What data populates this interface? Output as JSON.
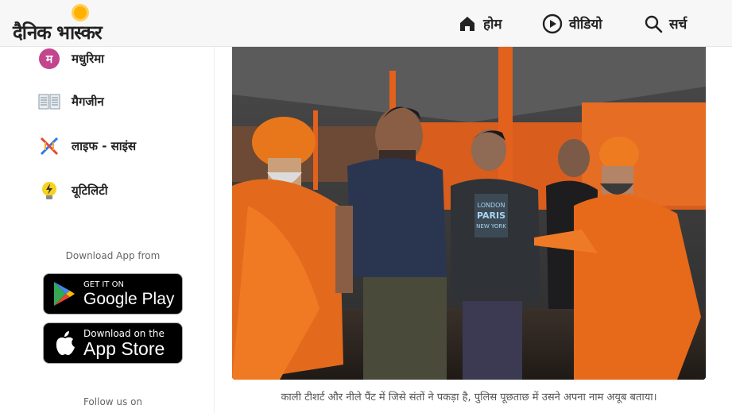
{
  "header": {
    "logo_text": "दैनिक भास्कर",
    "nav": [
      {
        "label": "होम",
        "icon": "home-icon"
      },
      {
        "label": "वीडियो",
        "icon": "play-circle-icon"
      },
      {
        "label": "सर्च",
        "icon": "search-icon"
      }
    ]
  },
  "sidebar": {
    "items": [
      {
        "label": "मधुरिमा",
        "icon": "madhurima-icon",
        "icon_letter": "म"
      },
      {
        "label": "मैगजीन",
        "icon": "magazine-icon"
      },
      {
        "label": "लाइफ - साइंस",
        "icon": "dna-icon"
      },
      {
        "label": "यूटिलिटी",
        "icon": "lightbulb-icon"
      }
    ],
    "download_label": "Download App from",
    "google_play": {
      "small": "GET IT ON",
      "big": "Google Play"
    },
    "app_store": {
      "small": "Download on the",
      "big": "App Store"
    },
    "follow_label": "Follow us on"
  },
  "article": {
    "photo_shirt_text": "LONDON PARIS NEW YORK",
    "caption": "काली टीशर्ट और नीले पैंट में जिसे संतों ने पकड़ा है, पुलिस पूछताछ में उसने अपना नाम अयूब बताया।"
  },
  "colors": {
    "saffron": "#e8661a",
    "header_bg": "#f7f7f7",
    "madhurima": "#c2458e"
  }
}
